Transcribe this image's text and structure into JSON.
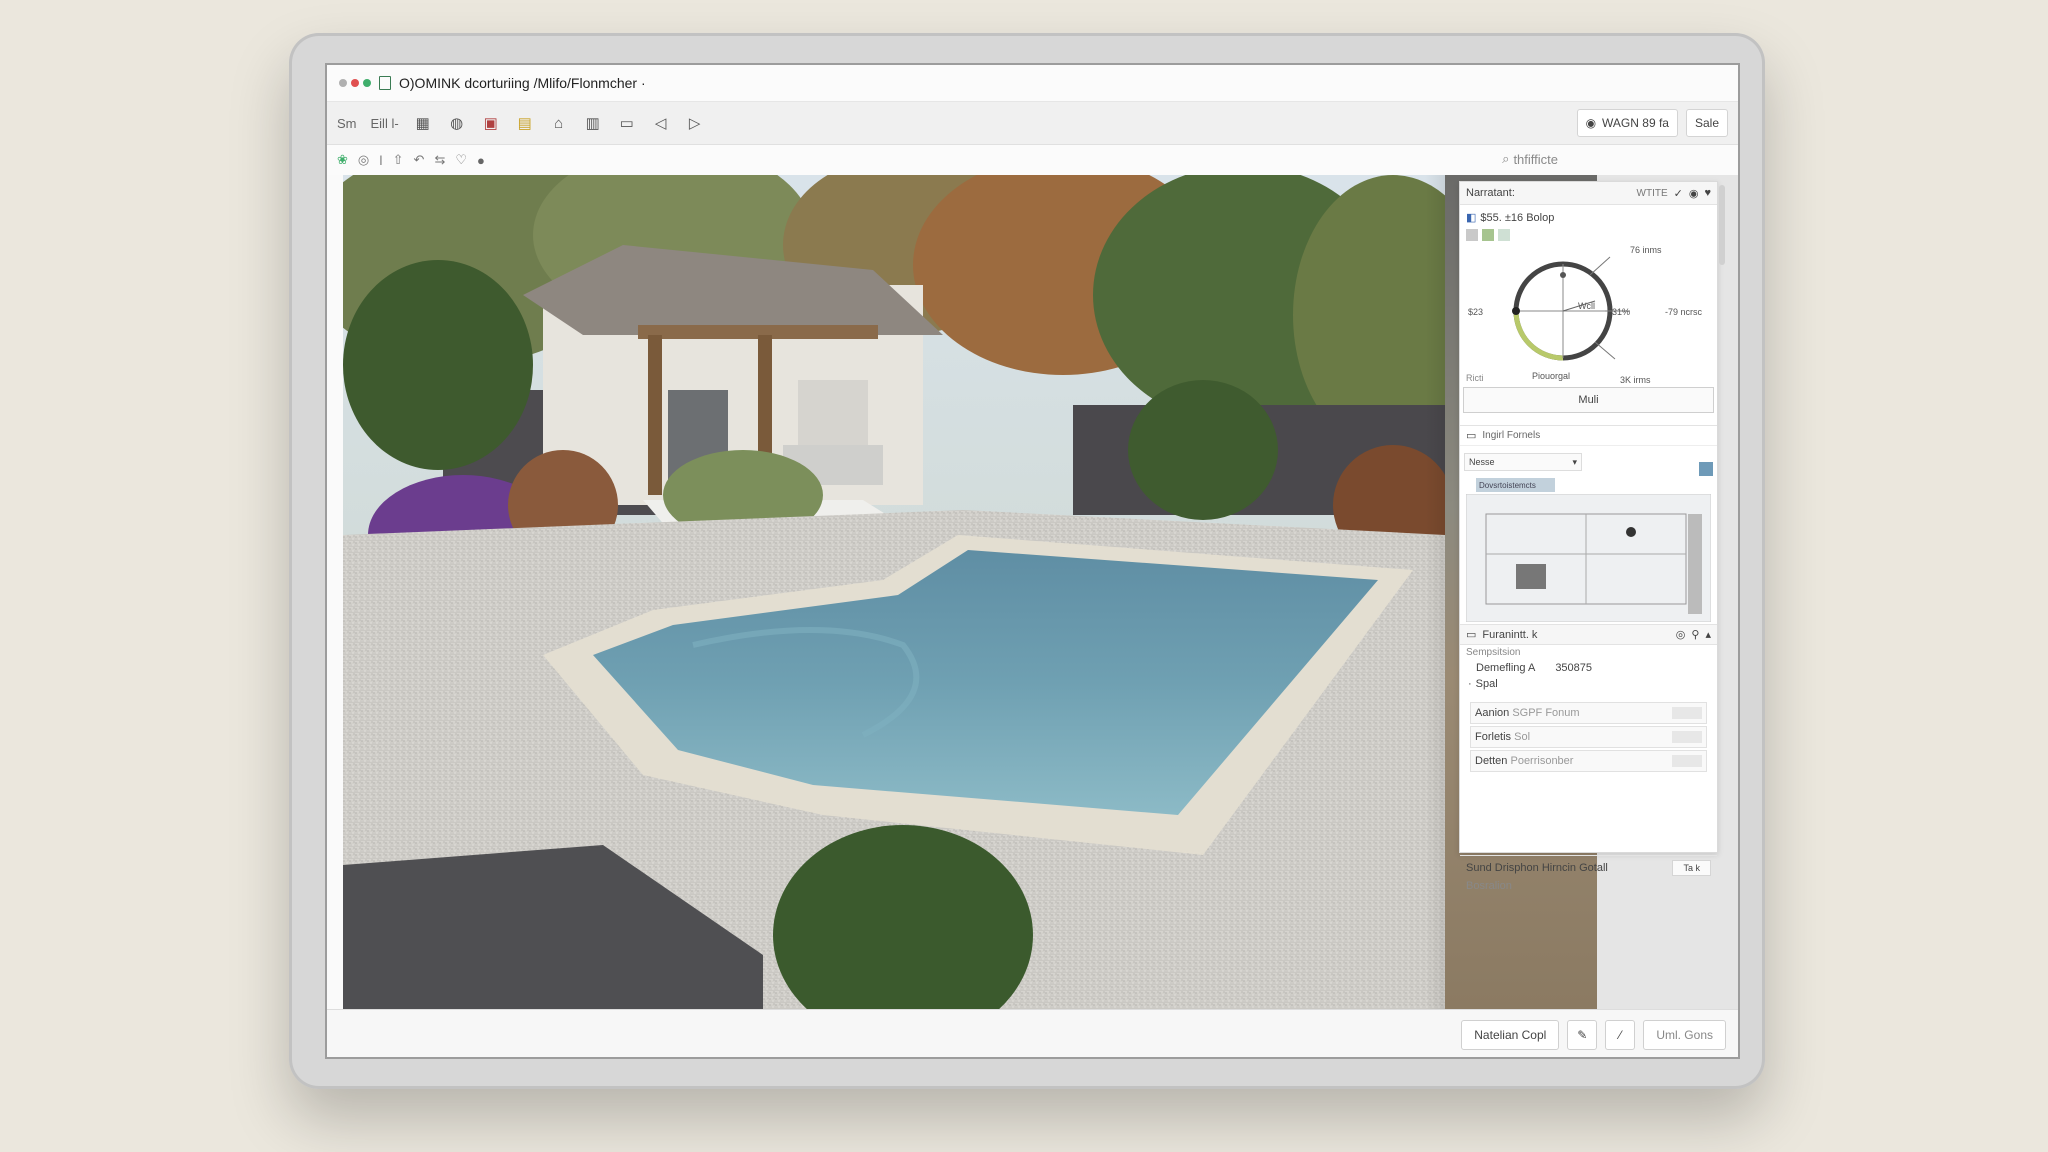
{
  "window": {
    "title": "O)OMINK dcorturiing /Mlifo/Flonmcher ·",
    "dot_colors": [
      "#b0b0b0",
      "#e05050",
      "#3fae6b"
    ]
  },
  "toolbar1": {
    "menu_a": "Sm",
    "menu_b": "Eill l-",
    "icons": [
      "layers-icon",
      "globe-icon",
      "book-icon",
      "palette-icon",
      "pin-icon",
      "grid-icon",
      "monitor-icon",
      "back-icon",
      "play-icon"
    ],
    "status_label": "WAGN 89 fa",
    "status_button": "Sale"
  },
  "toolbar2": {
    "icons": [
      "plant-icon",
      "compass-icon",
      "bar-icon",
      "upload-icon",
      "undo-icon",
      "share-icon",
      "heart-icon",
      "circle-icon"
    ],
    "search_text": "thfifficte"
  },
  "panel": {
    "header": {
      "title": "Narratant:",
      "tag": "WTITE"
    },
    "sun": {
      "title": "$55. ±16 Bolop",
      "label_top": "76 inms",
      "label_right_a": "31%",
      "label_right_b": "-79 ncrsc",
      "label_left": "$23",
      "label_bottom": "Piouorgal",
      "label_br": "3K irms",
      "center_label": "Wcll",
      "foot": "Ricti",
      "button": "Muli"
    },
    "ref": {
      "title": "Ingirl Fornels",
      "dropdown": "Nesse",
      "chip": "Dovsrtoistemcts"
    },
    "props": {
      "title": "Furanintt. k",
      "sub_label": "Sempsitsion",
      "line1_label": "Demefling A",
      "line1_value": "350875",
      "line2": "Spal",
      "fields": [
        {
          "label": "Aanion",
          "value": "SGPF Fonum"
        },
        {
          "label": "Forletis",
          "value": "Sol"
        },
        {
          "label": "Detten",
          "value": "Poerrisonber"
        }
      ]
    },
    "footer": {
      "line1": "Sund Drisphon Hirncin Gotall",
      "line1_button": "Ta k",
      "line2": "Bosralion"
    }
  },
  "bottombar": {
    "button_a": "Natelian Copl",
    "button_b": "Uml. Gons"
  }
}
